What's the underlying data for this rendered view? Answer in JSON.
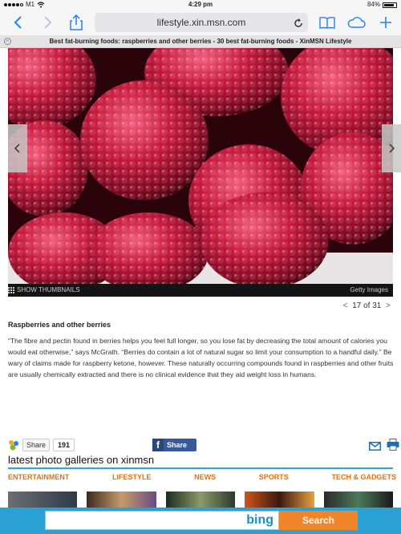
{
  "status_bar": {
    "carrier": "M1",
    "time": "4:29 pm",
    "battery": "84%"
  },
  "toolbar": {
    "url": "lifestyle.xin.msn.com",
    "icons": [
      "back-icon",
      "forward-icon",
      "share-icon",
      "reload-icon",
      "bookmarks-icon",
      "icloud-tabs-icon",
      "new-tab-icon"
    ]
  },
  "tab": {
    "title": "Best fat-burning foods: raspberries and other berries - 30 best fat-burning foods - XinMSN Lifestyle"
  },
  "photo": {
    "description_icon": "raspberries-photo",
    "show_thumbnails_label": "SHOW THUMBNAILS",
    "credit": "Getty Images"
  },
  "pager": {
    "text": "17 of 31"
  },
  "article": {
    "title": "Raspberries and other berries",
    "body": "“The fibre and pectin found in berries helps you feel full longer, so you lose fat by decreasing the total amount of calories you would eat otherwise,” says McGrath. “Berries do contain a lot of natural sugar so limit your consumption to a handful daily.” Be wary of claims made for raspberry ketone, however. These naturally occurring compounds found in raspberries and other fruits are usually chemically extracted and there is no clinical evidence that they aid weight loss in humans."
  },
  "social": {
    "share_label": "Share",
    "share_count": "191",
    "facebook_label": "Share"
  },
  "galleries": {
    "heading": "latest photo galleries on xinmsn",
    "categories": [
      "ENTERTAINMENT",
      "LIFESTYLE",
      "NEWS",
      "SPORTS",
      "TECH & GADGETS"
    ]
  },
  "bing": {
    "logo": "bing",
    "search_label": "Search"
  },
  "colors": {
    "safari_blue": "#2a7ff6",
    "bing_blue": "#2aa0d4",
    "search_orange": "#f2852a",
    "category_orange": "#e86f12",
    "facebook_blue": "#3b5998"
  }
}
